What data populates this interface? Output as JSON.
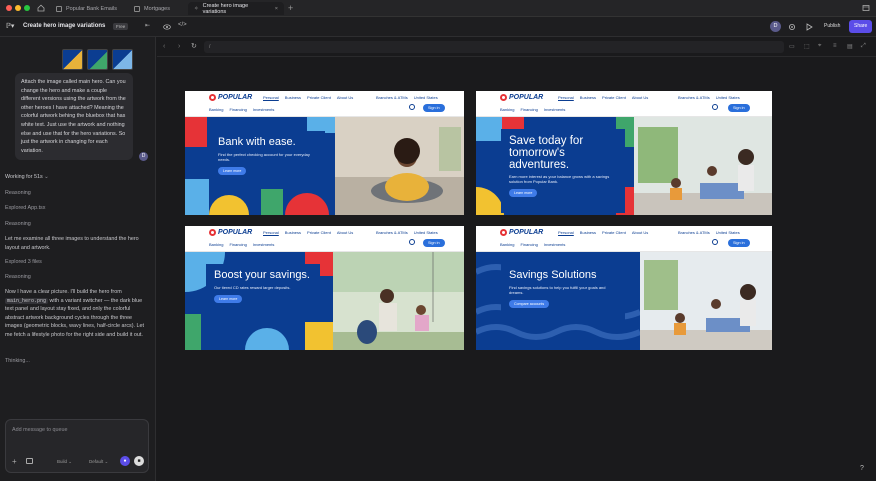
{
  "tabs": [
    {
      "label": "Popular Bank Emails"
    },
    {
      "label": "Mortgages"
    },
    {
      "label": "Create hero image variations"
    }
  ],
  "toolbar": {
    "project_title": "Create hero image variations",
    "plan_badge": "Free",
    "avatar_letter": "D",
    "publish_label": "Publish",
    "share_label": "Share"
  },
  "urlbar": {
    "path": "/"
  },
  "chat": {
    "user_message": "Attach the image called main hero. Can you change the hero and make a couple different versions using the artwork from the other heroes I have attached? Meaning the colorful artwork behing the bluebox that has white text. Just use the artwork and nothing else and use that for the hero variations. So just the artwork in changing for each variation.",
    "user_avatar": "D",
    "working": "Working for 51s",
    "reasoning_1": "Reasoning",
    "explored_1": "Explored App.tsx",
    "reasoning_2": "Reasoning",
    "assistant_1": "Let me examine all three images to understand the hero layout and artwork.",
    "explored_2": "Explored 3 files",
    "reasoning_3": "Reasoning",
    "assistant_2_a": "Now I have a clear picture. I'll build the hero from",
    "assistant_2_code": "main_hero.png",
    "assistant_2_b": "with a variant switcher — the dark blue text panel and layout stay fixed, and only the colorful abstract artwork background cycles through the three images (geometric blocks, wavy lines, half-circle arcs). Let me fetch a lifestyle photo for the right side and build it out.",
    "thinking": "Thinking...",
    "composer_placeholder": "Add message to queue",
    "mode_label": "Build",
    "model_label": "Default"
  },
  "site": {
    "logo": "POPULAR",
    "nav_links": [
      "Personal",
      "Business",
      "Private Client",
      "About Us"
    ],
    "nav_right": [
      "Branches & ATMs",
      "United States"
    ],
    "sub_links": [
      "Banking",
      "Financing",
      "Investments"
    ],
    "sign_in": "Sign in"
  },
  "cards": [
    {
      "title": "Bank with ease.",
      "body": "Find the perfect checking account for your everyday needs.",
      "cta": "Learn more"
    },
    {
      "title": "Save today for tomorrow's adventures.",
      "body": "Earn more interest as your balance grows with a savings solution from Popular Bank.",
      "cta": "Learn more"
    },
    {
      "title": "Boost your savings.",
      "body": "Our tiered CD rates reward larger deposits.",
      "cta": "Learn more"
    },
    {
      "title": "Savings Solutions",
      "body": "Find savings solutions to help you fulfill your goals and dreams.",
      "cta": "Compare accounts"
    }
  ],
  "colors": {
    "brand_blue": "#0b3d91",
    "brand_red": "#e63337",
    "accent": "#5b4de8"
  }
}
